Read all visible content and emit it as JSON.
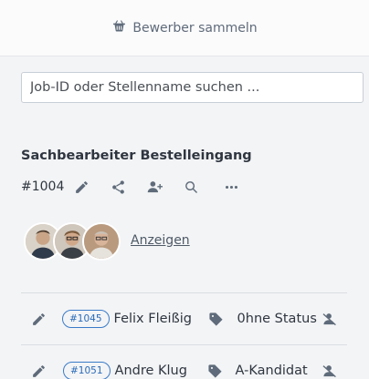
{
  "topbar": {
    "label": "Bewerber sammeln",
    "icon": "basket-icon"
  },
  "search": {
    "placeholder": "Job-ID oder Stellenname suchen ..."
  },
  "job": {
    "title": "Sachbearbeiter Bestelleingang",
    "id": "#1004",
    "actions": [
      "edit-icon",
      "share-icon",
      "add-user-icon",
      "search-icon",
      "more-icon"
    ]
  },
  "team": {
    "show_label": "Anzeigen",
    "avatar_count": 3
  },
  "candidates": [
    {
      "id": "#1045",
      "name": "Felix Fleißig",
      "status": "0hne Status"
    },
    {
      "id": "#1051",
      "name": "Andre Klug",
      "status": "A-Kandidat"
    }
  ],
  "colors": {
    "accent": "#2a6bb8",
    "icon": "#5f6b7a",
    "text": "#2f3640",
    "background": "#f3f4f6"
  }
}
